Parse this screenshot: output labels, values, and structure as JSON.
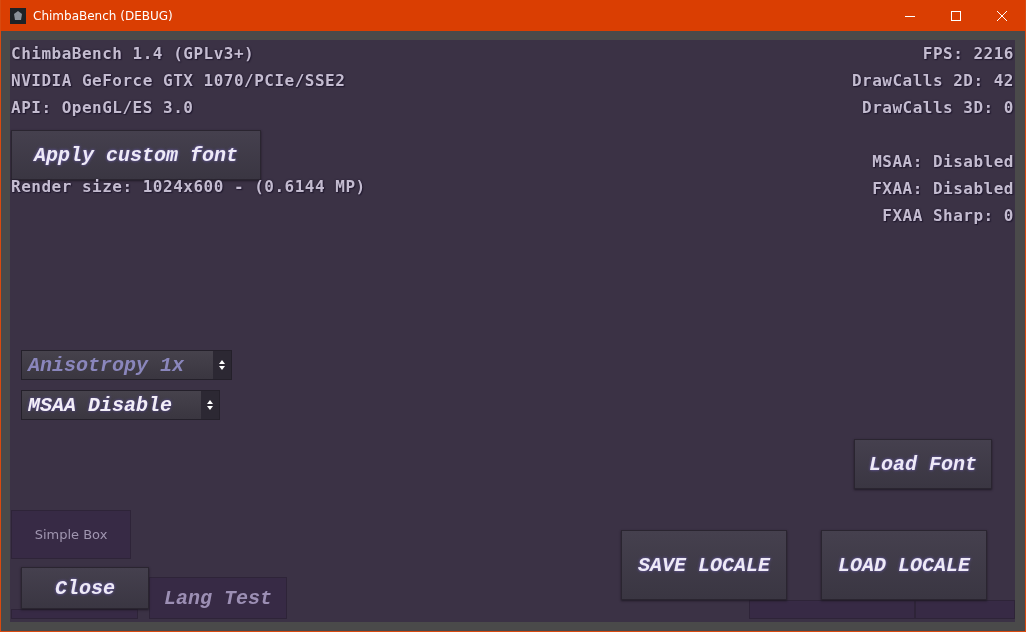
{
  "window": {
    "title": "ChimbaBench (DEBUG)"
  },
  "info_left": [
    "ChimbaBench 1.4 (GPLv3+)",
    "NVIDIA GeForce GTX 1070/PCIe/SSE2",
    "API: OpenGL/ES 3.0"
  ],
  "render_size": "Render size: 1024x600 - (0.6144 MP)",
  "info_right": [
    "FPS: 2216",
    "DrawCalls 2D: 42",
    "DrawCalls 3D: 0",
    "MSAA: Disabled",
    "FXAA: Disabled",
    "FXAA Sharp: 0"
  ],
  "dropdowns": [
    {
      "label": "Anisotropy 1x",
      "disabled": true
    },
    {
      "label": "MSAA Disable",
      "disabled": false
    }
  ],
  "buttons": [
    {
      "kind": "raised",
      "label": "Apply custom font"
    },
    {
      "kind": "box",
      "label": "Simple Box"
    },
    {
      "kind": "flat"
    },
    {
      "kind": "flat",
      "label": "Lang Test"
    },
    {
      "kind": "flat"
    },
    {
      "kind": "flat"
    },
    {
      "kind": "raised",
      "label": "Close"
    },
    {
      "kind": "raised",
      "label": "Load Font"
    },
    {
      "kind": "raised",
      "label": "SAVE LOCALE"
    },
    {
      "kind": "raised",
      "label": "LOAD LOCALE"
    }
  ]
}
